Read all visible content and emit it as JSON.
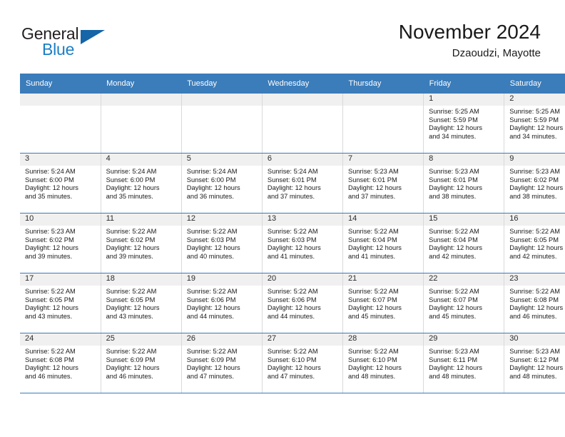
{
  "logo": {
    "word_general": "General",
    "word_blue": "Blue",
    "accent_color": "#1b7fc4",
    "triangle_color": "#1565a8"
  },
  "header": {
    "title": "November 2024",
    "subtitle": "Dzaoudzi, Mayotte"
  },
  "theme": {
    "header_blue": "#3b7cba",
    "day_band_gray": "#f0f0f0",
    "grid_line": "#d9d9d9"
  },
  "calendar": {
    "weekday_headers": [
      "Sunday",
      "Monday",
      "Tuesday",
      "Wednesday",
      "Thursday",
      "Friday",
      "Saturday"
    ],
    "weeks": [
      [
        {
          "day": "",
          "empty": true
        },
        {
          "day": "",
          "empty": true
        },
        {
          "day": "",
          "empty": true
        },
        {
          "day": "",
          "empty": true
        },
        {
          "day": "",
          "empty": true
        },
        {
          "day": "1",
          "sunrise": "Sunrise: 5:25 AM",
          "sunset": "Sunset: 5:59 PM",
          "daylight1": "Daylight: 12 hours",
          "daylight2": "and 34 minutes."
        },
        {
          "day": "2",
          "sunrise": "Sunrise: 5:25 AM",
          "sunset": "Sunset: 5:59 PM",
          "daylight1": "Daylight: 12 hours",
          "daylight2": "and 34 minutes."
        }
      ],
      [
        {
          "day": "3",
          "sunrise": "Sunrise: 5:24 AM",
          "sunset": "Sunset: 6:00 PM",
          "daylight1": "Daylight: 12 hours",
          "daylight2": "and 35 minutes."
        },
        {
          "day": "4",
          "sunrise": "Sunrise: 5:24 AM",
          "sunset": "Sunset: 6:00 PM",
          "daylight1": "Daylight: 12 hours",
          "daylight2": "and 35 minutes."
        },
        {
          "day": "5",
          "sunrise": "Sunrise: 5:24 AM",
          "sunset": "Sunset: 6:00 PM",
          "daylight1": "Daylight: 12 hours",
          "daylight2": "and 36 minutes."
        },
        {
          "day": "6",
          "sunrise": "Sunrise: 5:24 AM",
          "sunset": "Sunset: 6:01 PM",
          "daylight1": "Daylight: 12 hours",
          "daylight2": "and 37 minutes."
        },
        {
          "day": "7",
          "sunrise": "Sunrise: 5:23 AM",
          "sunset": "Sunset: 6:01 PM",
          "daylight1": "Daylight: 12 hours",
          "daylight2": "and 37 minutes."
        },
        {
          "day": "8",
          "sunrise": "Sunrise: 5:23 AM",
          "sunset": "Sunset: 6:01 PM",
          "daylight1": "Daylight: 12 hours",
          "daylight2": "and 38 minutes."
        },
        {
          "day": "9",
          "sunrise": "Sunrise: 5:23 AM",
          "sunset": "Sunset: 6:02 PM",
          "daylight1": "Daylight: 12 hours",
          "daylight2": "and 38 minutes."
        }
      ],
      [
        {
          "day": "10",
          "sunrise": "Sunrise: 5:23 AM",
          "sunset": "Sunset: 6:02 PM",
          "daylight1": "Daylight: 12 hours",
          "daylight2": "and 39 minutes."
        },
        {
          "day": "11",
          "sunrise": "Sunrise: 5:22 AM",
          "sunset": "Sunset: 6:02 PM",
          "daylight1": "Daylight: 12 hours",
          "daylight2": "and 39 minutes."
        },
        {
          "day": "12",
          "sunrise": "Sunrise: 5:22 AM",
          "sunset": "Sunset: 6:03 PM",
          "daylight1": "Daylight: 12 hours",
          "daylight2": "and 40 minutes."
        },
        {
          "day": "13",
          "sunrise": "Sunrise: 5:22 AM",
          "sunset": "Sunset: 6:03 PM",
          "daylight1": "Daylight: 12 hours",
          "daylight2": "and 41 minutes."
        },
        {
          "day": "14",
          "sunrise": "Sunrise: 5:22 AM",
          "sunset": "Sunset: 6:04 PM",
          "daylight1": "Daylight: 12 hours",
          "daylight2": "and 41 minutes."
        },
        {
          "day": "15",
          "sunrise": "Sunrise: 5:22 AM",
          "sunset": "Sunset: 6:04 PM",
          "daylight1": "Daylight: 12 hours",
          "daylight2": "and 42 minutes."
        },
        {
          "day": "16",
          "sunrise": "Sunrise: 5:22 AM",
          "sunset": "Sunset: 6:05 PM",
          "daylight1": "Daylight: 12 hours",
          "daylight2": "and 42 minutes."
        }
      ],
      [
        {
          "day": "17",
          "sunrise": "Sunrise: 5:22 AM",
          "sunset": "Sunset: 6:05 PM",
          "daylight1": "Daylight: 12 hours",
          "daylight2": "and 43 minutes."
        },
        {
          "day": "18",
          "sunrise": "Sunrise: 5:22 AM",
          "sunset": "Sunset: 6:05 PM",
          "daylight1": "Daylight: 12 hours",
          "daylight2": "and 43 minutes."
        },
        {
          "day": "19",
          "sunrise": "Sunrise: 5:22 AM",
          "sunset": "Sunset: 6:06 PM",
          "daylight1": "Daylight: 12 hours",
          "daylight2": "and 44 minutes."
        },
        {
          "day": "20",
          "sunrise": "Sunrise: 5:22 AM",
          "sunset": "Sunset: 6:06 PM",
          "daylight1": "Daylight: 12 hours",
          "daylight2": "and 44 minutes."
        },
        {
          "day": "21",
          "sunrise": "Sunrise: 5:22 AM",
          "sunset": "Sunset: 6:07 PM",
          "daylight1": "Daylight: 12 hours",
          "daylight2": "and 45 minutes."
        },
        {
          "day": "22",
          "sunrise": "Sunrise: 5:22 AM",
          "sunset": "Sunset: 6:07 PM",
          "daylight1": "Daylight: 12 hours",
          "daylight2": "and 45 minutes."
        },
        {
          "day": "23",
          "sunrise": "Sunrise: 5:22 AM",
          "sunset": "Sunset: 6:08 PM",
          "daylight1": "Daylight: 12 hours",
          "daylight2": "and 46 minutes."
        }
      ],
      [
        {
          "day": "24",
          "sunrise": "Sunrise: 5:22 AM",
          "sunset": "Sunset: 6:08 PM",
          "daylight1": "Daylight: 12 hours",
          "daylight2": "and 46 minutes."
        },
        {
          "day": "25",
          "sunrise": "Sunrise: 5:22 AM",
          "sunset": "Sunset: 6:09 PM",
          "daylight1": "Daylight: 12 hours",
          "daylight2": "and 46 minutes."
        },
        {
          "day": "26",
          "sunrise": "Sunrise: 5:22 AM",
          "sunset": "Sunset: 6:09 PM",
          "daylight1": "Daylight: 12 hours",
          "daylight2": "and 47 minutes."
        },
        {
          "day": "27",
          "sunrise": "Sunrise: 5:22 AM",
          "sunset": "Sunset: 6:10 PM",
          "daylight1": "Daylight: 12 hours",
          "daylight2": "and 47 minutes."
        },
        {
          "day": "28",
          "sunrise": "Sunrise: 5:22 AM",
          "sunset": "Sunset: 6:10 PM",
          "daylight1": "Daylight: 12 hours",
          "daylight2": "and 48 minutes."
        },
        {
          "day": "29",
          "sunrise": "Sunrise: 5:23 AM",
          "sunset": "Sunset: 6:11 PM",
          "daylight1": "Daylight: 12 hours",
          "daylight2": "and 48 minutes."
        },
        {
          "day": "30",
          "sunrise": "Sunrise: 5:23 AM",
          "sunset": "Sunset: 6:12 PM",
          "daylight1": "Daylight: 12 hours",
          "daylight2": "and 48 minutes."
        }
      ]
    ]
  }
}
